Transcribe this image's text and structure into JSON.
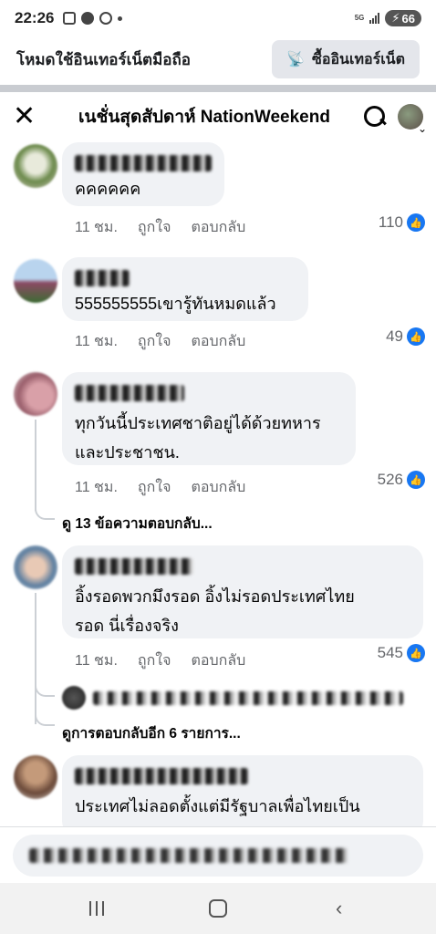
{
  "status_bar": {
    "time": "22:26",
    "network": "5G",
    "battery": "66"
  },
  "free_mode": {
    "label": "โหมดใช้อินเทอร์เน็ตมือถือ",
    "buy_button": "ซื้ออินเทอร์เน็ต",
    "buy_icon": "broadcast-icon"
  },
  "header": {
    "close_icon": "close-icon",
    "title": "เนชั่นสุดสัปดาห์ NationWeekend",
    "search_icon": "search-icon"
  },
  "comments": [
    {
      "text": "คคคคคค",
      "time": "11 ชม.",
      "like_label": "ถูกใจ",
      "reply_label": "ตอบกลับ",
      "likes": "110"
    },
    {
      "text": "555555555เขารู้ทันหมดแล้ว",
      "time": "11 ชม.",
      "like_label": "ถูกใจ",
      "reply_label": "ตอบกลับ",
      "likes": "49"
    },
    {
      "text_line1": "ทุกวันนี้ประเทศชาติอยู่ได้ด้วยทหาร",
      "text_line2": "และประชาชน.",
      "time": "11 ชม.",
      "like_label": "ถูกใจ",
      "reply_label": "ตอบกลับ",
      "likes": "526",
      "view_replies": "ดู 13 ข้อความตอบกลับ..."
    },
    {
      "text_line1": "อิ้งรอดพวกมึงรอด อิ้งไม่รอดประเทศไทย",
      "text_line2": "รอด นี่เรื่องจริง",
      "time": "11 ชม.",
      "like_label": "ถูกใจ",
      "reply_label": "ตอบกลับ",
      "likes": "545",
      "view_more_replies": "ดูการตอบกลับอีก 6 รายการ..."
    },
    {
      "text_line1": "ประเทศไม่ลอดตั้งแต่มีรัฐบาลเพื่อไทยเป็น"
    }
  ],
  "colors": {
    "like_blue": "#1877f2",
    "bubble_bg": "#f0f2f5",
    "meta_gray": "#65676b"
  }
}
